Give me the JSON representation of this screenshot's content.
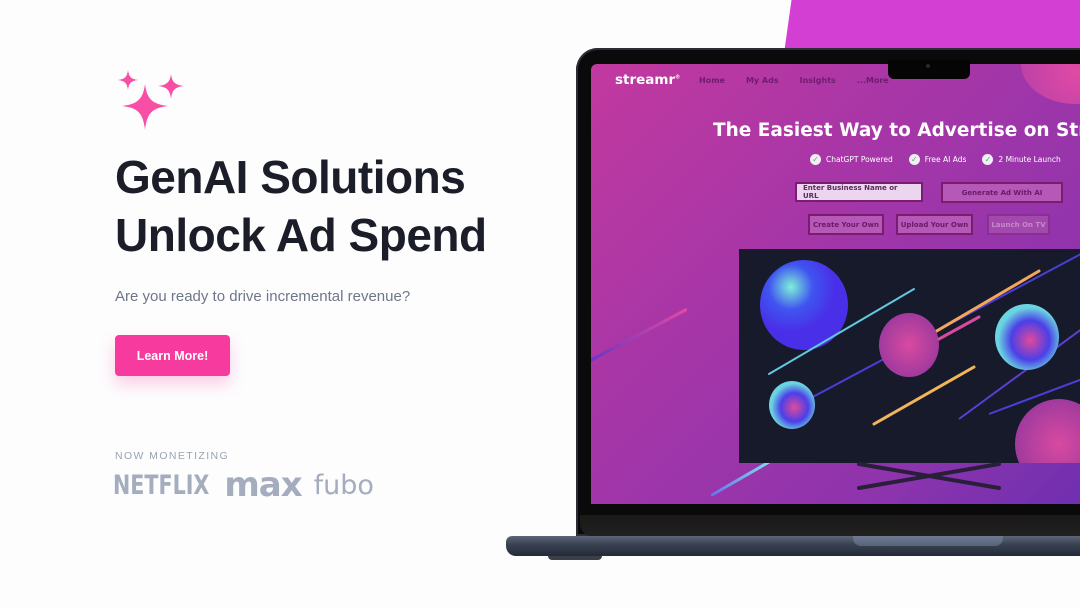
{
  "hero": {
    "headline_line1": "GenAI Solutions",
    "headline_line2": "Unlock Ad Spend",
    "subtitle": "Are you ready to drive incremental revenue?",
    "cta_label": "Learn More!",
    "accent_color": "#f73a9d",
    "icon": "sparkles-icon"
  },
  "partners": {
    "label": "NOW MONETIZING",
    "logos": [
      "NETFLIX",
      "max",
      "fubo"
    ]
  },
  "laptop_screen": {
    "brand": "streamr",
    "brand_mark": "®",
    "nav": [
      "Home",
      "My Ads",
      "Insights",
      "...More"
    ],
    "hero_title": "The Easiest Way to Advertise on Streaming",
    "features": [
      "ChatGPT Powered",
      "Free AI Ads",
      "2 Minute Launch"
    ],
    "business_input_placeholder": "Enter Business Name or URL",
    "buttons": {
      "generate": "Generate Ad With AI",
      "create": "Create Your Own",
      "upload": "Upload Your Own",
      "launch": "Launch On TV"
    }
  }
}
